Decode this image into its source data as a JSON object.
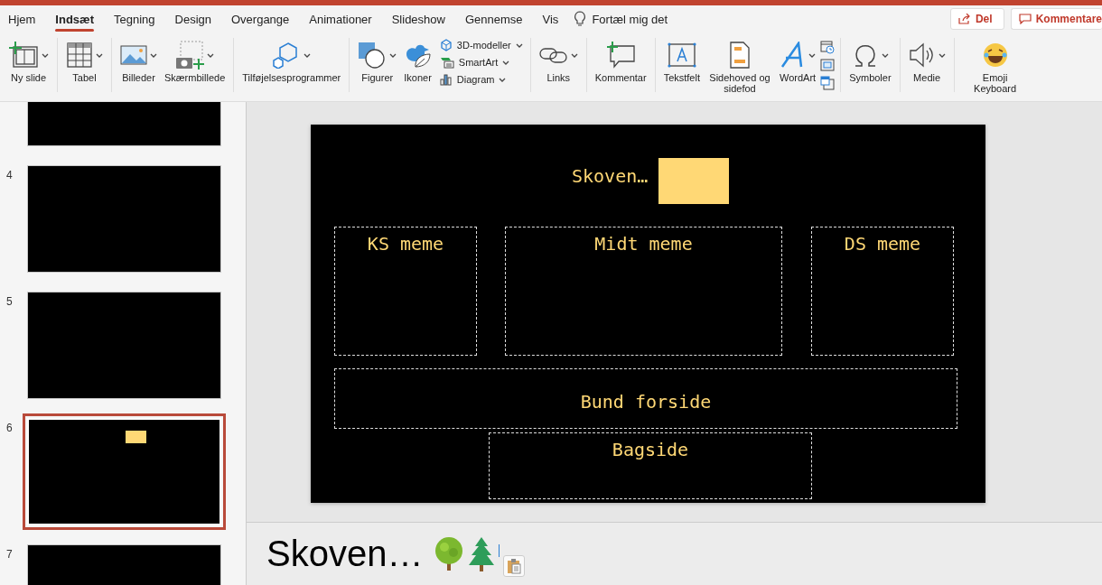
{
  "tabs": [
    {
      "label": "Hjem",
      "selected": false
    },
    {
      "label": "Indsæt",
      "selected": true
    },
    {
      "label": "Tegning",
      "selected": false
    },
    {
      "label": "Design",
      "selected": false
    },
    {
      "label": "Overgange",
      "selected": false
    },
    {
      "label": "Animationer",
      "selected": false
    },
    {
      "label": "Slideshow",
      "selected": false
    },
    {
      "label": "Gennemse",
      "selected": false
    },
    {
      "label": "Vis",
      "selected": false
    }
  ],
  "tell_me": "Fortæl mig det",
  "share_button": "Del",
  "comments_button": "Kommentare",
  "ribbon": {
    "groups": [
      {
        "items": [
          {
            "kind": "large",
            "label": "Ny slide",
            "caret": true
          }
        ]
      },
      {
        "items": [
          {
            "kind": "large",
            "label": "Tabel",
            "caret": true
          }
        ]
      },
      {
        "items": [
          {
            "kind": "large",
            "label": "Billeder",
            "caret": true
          },
          {
            "kind": "large",
            "label": "Skærmbillede",
            "caret": true
          }
        ]
      },
      {
        "items": [
          {
            "kind": "large",
            "label": "Tilføjelsesprogrammer",
            "caret": true
          }
        ]
      },
      {
        "items": [
          {
            "kind": "large",
            "label": "Figurer",
            "caret": true
          },
          {
            "kind": "large",
            "label": "Ikoner",
            "caret": false
          },
          {
            "kind": "small",
            "labels": [
              "3D-modeller",
              "SmartArt",
              "Diagram"
            ]
          }
        ]
      },
      {
        "items": [
          {
            "kind": "large",
            "label": "Links",
            "caret": true
          }
        ]
      },
      {
        "items": [
          {
            "kind": "large",
            "label": "Kommentar",
            "caret": false
          }
        ]
      },
      {
        "items": [
          {
            "kind": "large",
            "label": "Tekstfelt",
            "caret": false
          },
          {
            "kind": "large",
            "label": "Sidehoved og sidefod",
            "caret": false
          },
          {
            "kind": "large",
            "label": "WordArt",
            "caret": true
          },
          {
            "kind": "icons"
          }
        ]
      },
      {
        "items": [
          {
            "kind": "large",
            "label": "Symboler",
            "caret": true
          }
        ]
      },
      {
        "items": [
          {
            "kind": "large",
            "label": "Medie",
            "caret": true
          }
        ]
      },
      {
        "items": [
          {
            "kind": "large",
            "label": "Emoji Keyboard",
            "caret": false
          }
        ]
      }
    ]
  },
  "slides": [
    {
      "selected": false,
      "has_title_box": false
    },
    {
      "number": "4",
      "selected": false,
      "has_title_box": false
    },
    {
      "number": "5",
      "selected": false,
      "has_title_box": false
    },
    {
      "number": "6",
      "selected": true,
      "has_title_box": true
    },
    {
      "number": "7",
      "selected": false,
      "has_title_box": false
    }
  ],
  "slide": {
    "title": "Skoven…",
    "placeholders": [
      "KS meme",
      "Midt meme",
      "DS meme",
      "Bund forside",
      "Bagside"
    ]
  },
  "notes": "Skoven…"
}
